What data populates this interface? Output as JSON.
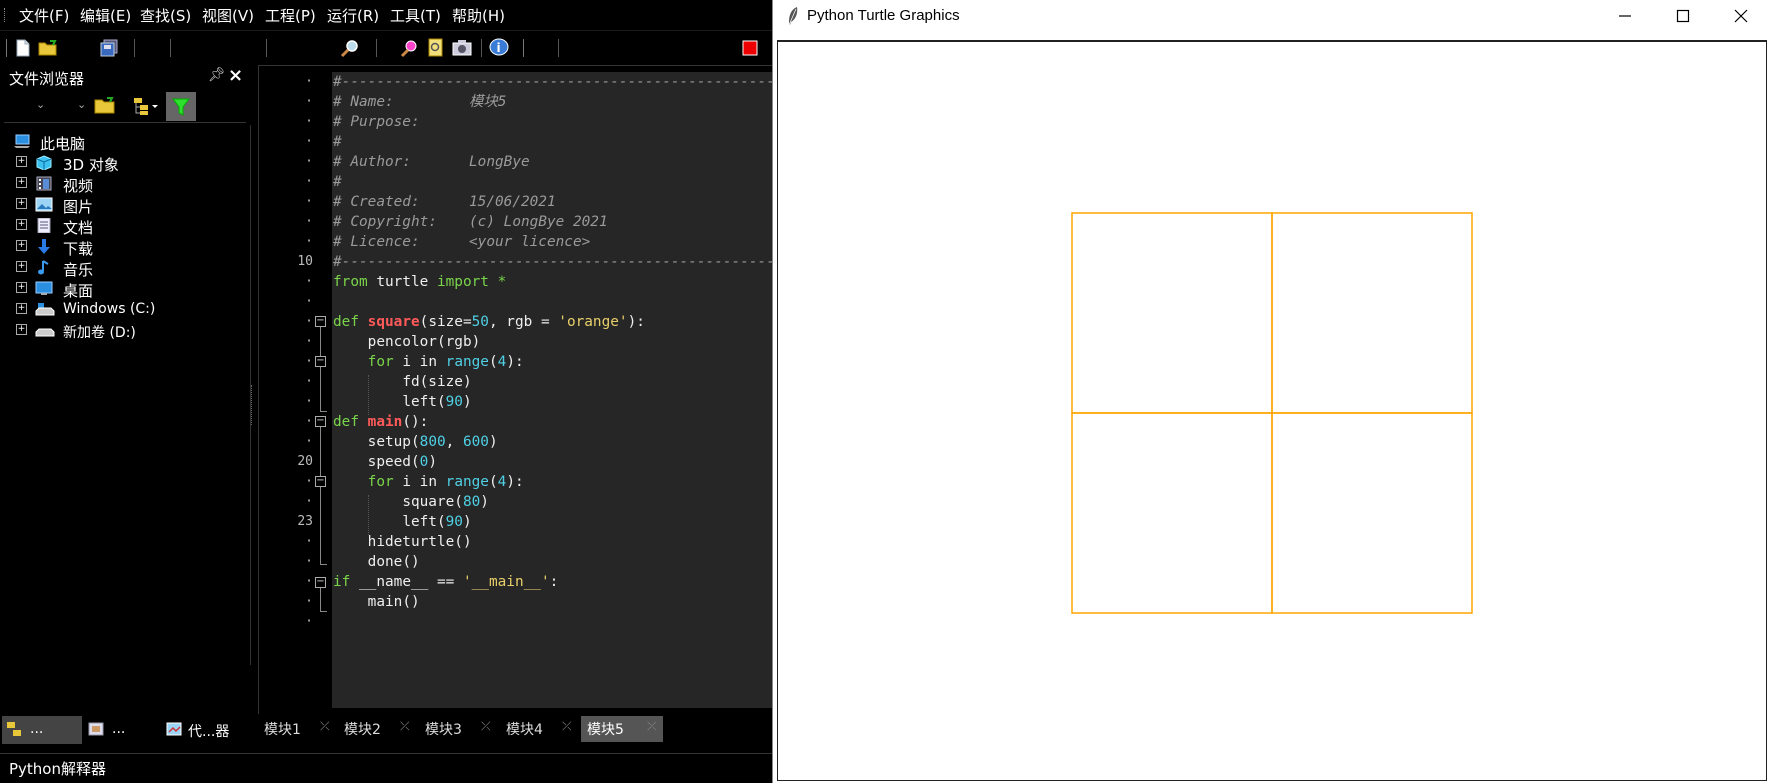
{
  "ide": {
    "menu": [
      "文件(F)",
      "编辑(E)",
      "查找(S)",
      "视图(V)",
      "工程(P)",
      "运行(R)",
      "工具(T)",
      "帮助(H)"
    ],
    "file_browser": {
      "title": "文件浏览器",
      "tree": {
        "root": "此电脑",
        "items": [
          {
            "label": "3D 对象",
            "icon": "cube-icon"
          },
          {
            "label": "视频",
            "icon": "film-icon"
          },
          {
            "label": "图片",
            "icon": "image-icon"
          },
          {
            "label": "文档",
            "icon": "document-icon"
          },
          {
            "label": "下载",
            "icon": "download-arrow-icon"
          },
          {
            "label": "音乐",
            "icon": "music-note-icon"
          },
          {
            "label": "桌面",
            "icon": "desktop-icon"
          },
          {
            "label": "Windows (C:)",
            "icon": "drive-icon"
          },
          {
            "label": "新加卷 (D:)",
            "icon": "drive-icon"
          }
        ]
      },
      "bottom_tabs": [
        "...",
        "...",
        "代...器"
      ]
    },
    "editor": {
      "line_numbers": {
        "l1": "10",
        "l2": "20",
        "l3": "23"
      },
      "lines": {
        "c1": "#------------------------------------------------------------",
        "c2a": "# Name:",
        "c2b": "模块5",
        "c3": "# Purpose:",
        "c4": "#",
        "c5a": "# Author:",
        "c5b": "LongBye",
        "c6": "#",
        "c7a": "# Created:",
        "c7b": "15/06/2021",
        "c8a": "# Copyright:",
        "c8b": "(c) LongBye 2021",
        "c9a": "# Licence:",
        "c9b": "<your licence>",
        "c10": "#------------------------------------------------------------",
        "from": "from",
        "turtle": "turtle",
        "import": "import",
        "star": "*",
        "def": "def",
        "square": "square",
        "sq_args1": "(size=",
        "fifty": "50",
        "sq_args2": ", rgb = ",
        "orange": "'orange'",
        "sq_args3": "):",
        "pencolor": "pencolor",
        "pencolor_args": "(rgb)",
        "for": "for",
        "i_in": "i in",
        "range": "range",
        "range4_paren1": "(",
        "four": "4",
        "range4_paren2": "):",
        "fd": "fd",
        "fd_args": "(size)",
        "left": "left",
        "paren_open": "(",
        "ninety": "90",
        "paren_close": ")",
        "main": "main",
        "main_args": "():",
        "setup": "setup",
        "eight_hundred": "800",
        "comma": ", ",
        "six_hundred": "600",
        "speed": "speed",
        "zero": "0",
        "square_call": "square",
        "eighty": "80",
        "hideturtle": "hideturtle",
        "empty_call": "()",
        "done": "done",
        "if": "if",
        "name_eq": "__name__ == ",
        "main_str": "'__main__'",
        "colon": ":",
        "main_call": "main"
      }
    },
    "editor_tabs": [
      "模块1",
      "模块2",
      "模块3",
      "模块4",
      "模块5"
    ],
    "active_tab": "模块5",
    "status": "Python解释器"
  },
  "turtle_window": {
    "title": "Python Turtle Graphics",
    "controls": [
      "minimize-icon",
      "maximize-icon",
      "close-icon"
    ],
    "drawing": {
      "pen_color": "#ffa500",
      "square_size": 80,
      "count": 4
    }
  }
}
